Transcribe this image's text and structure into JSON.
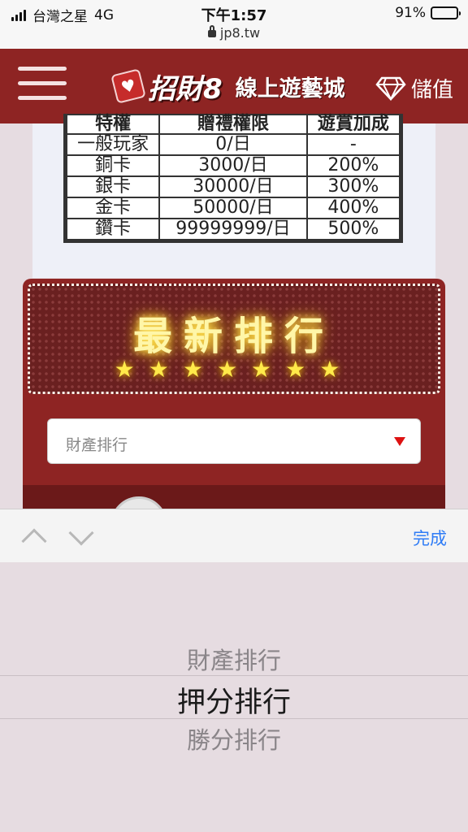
{
  "status_bar": {
    "carrier": "台灣之星",
    "network": "4G",
    "time": "下午1:57",
    "url": "jp8.tw",
    "battery": "91%",
    "battery_level": 0.91
  },
  "header": {
    "logo_main": "招財8",
    "logo_sub": "線上遊藝城",
    "deposit_label": "儲值"
  },
  "privilege_table": {
    "headers": [
      "特權",
      "贈禮權限",
      "遊賞加成"
    ],
    "rows": [
      [
        "一般玩家",
        "0/日",
        "-"
      ],
      [
        "銅卡",
        "3000/日",
        "200%"
      ],
      [
        "銀卡",
        "30000/日",
        "300%"
      ],
      [
        "金卡",
        "50000/日",
        "400%"
      ],
      [
        "鑽卡",
        "99999999/日",
        "500%"
      ]
    ]
  },
  "ranking": {
    "title": "最新排行",
    "stars": "★★★★★★★",
    "select_value": "財產排行"
  },
  "toolbar": {
    "done_label": "完成"
  },
  "picker": {
    "options": [
      "財產排行",
      "押分排行",
      "勝分排行"
    ],
    "selected_index": 1
  },
  "colors": {
    "brand_red": "#8e2423",
    "ios_blue": "#2f7cf6",
    "neon_yellow": "#fff6a8"
  }
}
